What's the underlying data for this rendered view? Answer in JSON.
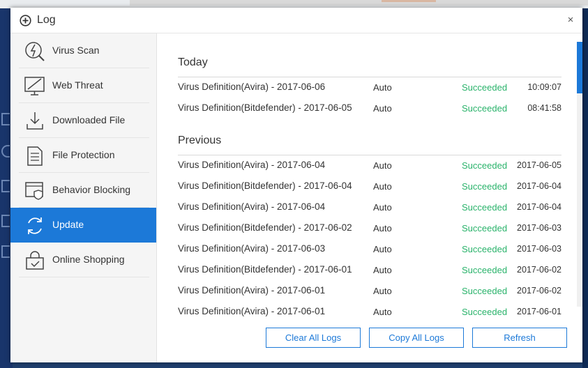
{
  "window": {
    "title": "Log",
    "close_label": "×"
  },
  "sidebar": {
    "items": [
      {
        "label": "Virus Scan",
        "icon": "virus-scan-icon"
      },
      {
        "label": "Web Threat",
        "icon": "web-threat-icon"
      },
      {
        "label": "Downloaded File",
        "icon": "download-icon"
      },
      {
        "label": "File Protection",
        "icon": "file-protection-icon"
      },
      {
        "label": "Behavior Blocking",
        "icon": "behavior-blocking-icon"
      },
      {
        "label": "Update",
        "icon": "update-icon",
        "active": true
      },
      {
        "label": "Online Shopping",
        "icon": "online-shopping-icon"
      }
    ]
  },
  "log": {
    "today_title": "Today",
    "previous_title": "Previous",
    "status_color": "#2ab36b",
    "today": [
      {
        "name": "Virus Definition(Avira) - 2017-06-06",
        "mode": "Auto",
        "status": "Succeeded",
        "time": "10:09:07"
      },
      {
        "name": "Virus Definition(Bitdefender) - 2017-06-05",
        "mode": "Auto",
        "status": "Succeeded",
        "time": "08:41:58"
      }
    ],
    "previous": [
      {
        "name": "Virus Definition(Avira) - 2017-06-04",
        "mode": "Auto",
        "status": "Succeeded",
        "time": "2017-06-05"
      },
      {
        "name": "Virus Definition(Bitdefender) - 2017-06-04",
        "mode": "Auto",
        "status": "Succeeded",
        "time": "2017-06-04"
      },
      {
        "name": "Virus Definition(Avira) - 2017-06-04",
        "mode": "Auto",
        "status": "Succeeded",
        "time": "2017-06-04"
      },
      {
        "name": "Virus Definition(Bitdefender) - 2017-06-02",
        "mode": "Auto",
        "status": "Succeeded",
        "time": "2017-06-03"
      },
      {
        "name": "Virus Definition(Avira) - 2017-06-03",
        "mode": "Auto",
        "status": "Succeeded",
        "time": "2017-06-03"
      },
      {
        "name": "Virus Definition(Bitdefender) - 2017-06-01",
        "mode": "Auto",
        "status": "Succeeded",
        "time": "2017-06-02"
      },
      {
        "name": "Virus Definition(Avira) - 2017-06-01",
        "mode": "Auto",
        "status": "Succeeded",
        "time": "2017-06-02"
      },
      {
        "name": "Virus Definition(Avira) - 2017-06-01",
        "mode": "Auto",
        "status": "Succeeded",
        "time": "2017-06-01"
      }
    ]
  },
  "buttons": {
    "clear": "Clear All Logs",
    "copy": "Copy All Logs",
    "refresh": "Refresh"
  },
  "colors": {
    "accent": "#1c79d8",
    "success": "#2ab36b"
  }
}
